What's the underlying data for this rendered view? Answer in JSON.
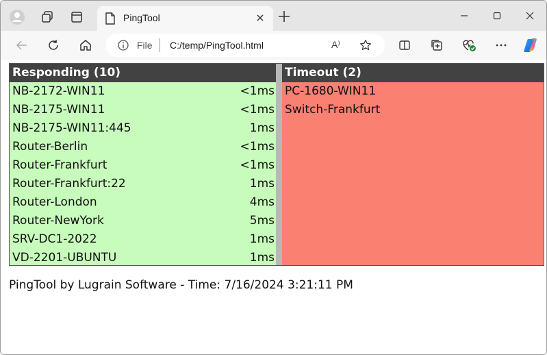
{
  "browser": {
    "tab_title": "PingTool",
    "address_scheme": "File",
    "address_url": "C:/temp/PingTool.html",
    "read_aloud_label": "A⁾"
  },
  "responding": {
    "header": "Responding (10)",
    "rows": [
      {
        "host": "NB-2172-WIN11",
        "time": "<1ms"
      },
      {
        "host": "NB-2175-WIN11",
        "time": "<1ms"
      },
      {
        "host": "NB-2175-WIN11:445",
        "time": "1ms"
      },
      {
        "host": "Router-Berlin",
        "time": "<1ms"
      },
      {
        "host": "Router-Frankfurt",
        "time": "<1ms"
      },
      {
        "host": "Router-Frankfurt:22",
        "time": "1ms"
      },
      {
        "host": "Router-London",
        "time": "4ms"
      },
      {
        "host": "Router-NewYork",
        "time": "5ms"
      },
      {
        "host": "SRV-DC1-2022",
        "time": "1ms"
      },
      {
        "host": "VD-2201-UBUNTU",
        "time": "1ms"
      }
    ]
  },
  "timeout": {
    "header": "Timeout (2)",
    "rows": [
      {
        "host": "PC-1680-WIN11"
      },
      {
        "host": "Switch-Frankfurt"
      }
    ]
  },
  "footer": "PingTool by Lugrain Software - Time: 7/16/2024 3:21:11 PM",
  "colors": {
    "responding_bg": "#c8fcbc",
    "timeout_bg": "#fa8072",
    "header_bg": "#424242",
    "divider": "#b8b8b8"
  }
}
